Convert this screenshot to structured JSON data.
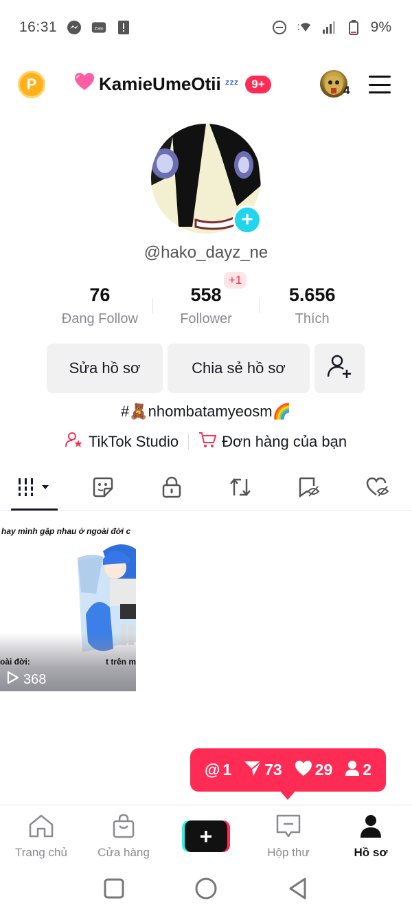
{
  "status_bar": {
    "time": "16:31",
    "battery": "9%"
  },
  "header": {
    "coin_letter": "P",
    "title": "KamieUmeOtii",
    "title_suffix": "ᶻᶻᶻ",
    "notification_badge": "9+",
    "accounts_count": "4"
  },
  "profile": {
    "handle": "@hako_dayz_ne",
    "stats": [
      {
        "value": "76",
        "label": "Đang Follow"
      },
      {
        "value": "558",
        "label": "Follower"
      },
      {
        "value": "5.656",
        "label": "Thích"
      }
    ],
    "new_followers_badge": "+1",
    "edit_button": "Sửa hồ sơ",
    "share_button": "Chia sẻ hồ sơ",
    "bio": "#🧸nhombatamyeosm🌈",
    "link_studio": "TikTok Studio",
    "link_orders": "Đơn hàng của bạn"
  },
  "tabs": [
    "videos",
    "stickers",
    "private",
    "reposts",
    "saved-hidden",
    "liked-hidden"
  ],
  "video": {
    "caption_top": "hay mình gặp nhau ở ngoài đời c",
    "caption_left": "oài đời:",
    "caption_right": "t trên m",
    "views": "368"
  },
  "activity": {
    "mentions": "1",
    "shares": "73",
    "likes": "29",
    "followers": "2"
  },
  "bottom_nav": {
    "home": "Trang chủ",
    "shop": "Cửa hàng",
    "inbox": "Hộp thư",
    "profile": "Hồ sơ"
  },
  "colors": {
    "accent": "#fe2c55",
    "cyan": "#25f4ee",
    "coin": "#ffb11b",
    "avatar_add": "#20d5ec"
  }
}
